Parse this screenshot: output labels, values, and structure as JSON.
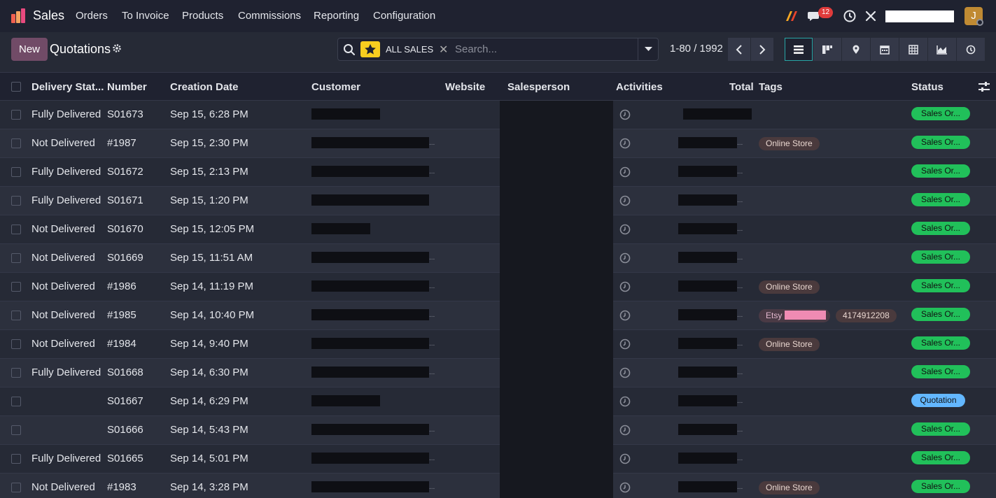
{
  "navbar": {
    "app_name": "Sales",
    "menus": [
      "Orders",
      "To Invoice",
      "Products",
      "Commissions",
      "Reporting",
      "Configuration"
    ],
    "messages_count": "12",
    "user_initial": "J"
  },
  "control": {
    "new_label": "New",
    "title": "Quotations",
    "facet": "ALL SALES",
    "search_placeholder": "Search...",
    "pager": "1-80 / 1992"
  },
  "columns": {
    "delivery": "Delivery Stat...",
    "number": "Number",
    "date": "Creation Date",
    "customer": "Customer",
    "website": "Website",
    "salesperson": "Salesperson",
    "activities": "Activities",
    "total": "Total",
    "tags": "Tags",
    "status": "Status"
  },
  "rows": [
    {
      "delivery": "Fully Delivered",
      "number": "S01673",
      "date": "Sep 15, 6:28 PM",
      "tags": [],
      "status": "Sales Or...",
      "status_color": "#21c05a"
    },
    {
      "delivery": "Not Delivered",
      "number": "#1987",
      "date": "Sep 15, 2:30 PM",
      "tags": [
        "Online Store"
      ],
      "status": "Sales Or...",
      "status_color": "#21c05a"
    },
    {
      "delivery": "Fully Delivered",
      "number": "S01672",
      "date": "Sep 15, 2:13 PM",
      "tags": [],
      "status": "Sales Or...",
      "status_color": "#21c05a"
    },
    {
      "delivery": "Fully Delivered",
      "number": "S01671",
      "date": "Sep 15, 1:20 PM",
      "tags": [],
      "status": "Sales Or...",
      "status_color": "#21c05a"
    },
    {
      "delivery": "Not Delivered",
      "number": "S01670",
      "date": "Sep 15, 12:05 PM",
      "tags": [],
      "status": "Sales Or...",
      "status_color": "#21c05a"
    },
    {
      "delivery": "Not Delivered",
      "number": "S01669",
      "date": "Sep 15, 11:51 AM",
      "tags": [],
      "status": "Sales Or...",
      "status_color": "#21c05a"
    },
    {
      "delivery": "Not Delivered",
      "number": "#1986",
      "date": "Sep 14, 11:19 PM",
      "tags": [
        "Online Store"
      ],
      "status": "Sales Or...",
      "status_color": "#21c05a"
    },
    {
      "delivery": "Not Delivered",
      "number": "#1985",
      "date": "Sep 14, 10:40 PM",
      "tags": [
        "Etsy",
        "4174912208"
      ],
      "status": "Sales Or...",
      "status_color": "#21c05a"
    },
    {
      "delivery": "Not Delivered",
      "number": "#1984",
      "date": "Sep 14, 9:40 PM",
      "tags": [
        "Online Store"
      ],
      "status": "Sales Or...",
      "status_color": "#21c05a"
    },
    {
      "delivery": "Fully Delivered",
      "number": "S01668",
      "date": "Sep 14, 6:30 PM",
      "tags": [],
      "status": "Sales Or...",
      "status_color": "#21c05a"
    },
    {
      "delivery": "",
      "number": "S01667",
      "date": "Sep 14, 6:29 PM",
      "tags": [],
      "status": "Quotation",
      "status_color": "#63b7ff"
    },
    {
      "delivery": "",
      "number": "S01666",
      "date": "Sep 14, 5:43 PM",
      "tags": [],
      "status": "Sales Or...",
      "status_color": "#21c05a"
    },
    {
      "delivery": "Fully Delivered",
      "number": "S01665",
      "date": "Sep 14, 5:01 PM",
      "tags": [],
      "status": "Sales Or...",
      "status_color": "#21c05a"
    },
    {
      "delivery": "Not Delivered",
      "number": "#1983",
      "date": "Sep 14, 3:28 PM",
      "tags": [
        "Online Store"
      ],
      "status": "Sales Or...",
      "status_color": "#21c05a"
    }
  ]
}
